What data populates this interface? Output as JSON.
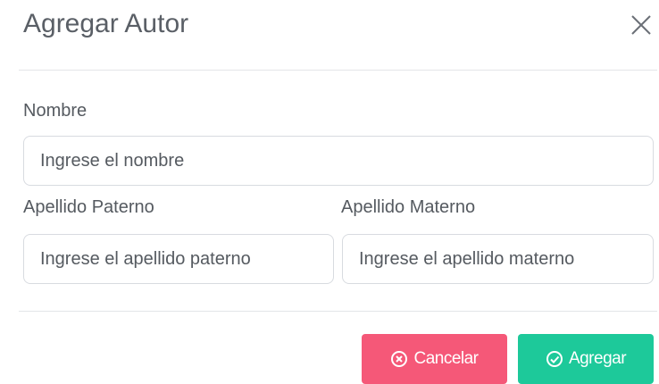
{
  "modal": {
    "title": "Agregar Autor",
    "close_icon": "close-icon"
  },
  "form": {
    "nombre": {
      "label": "Nombre",
      "placeholder": "Ingrese el nombre",
      "value": ""
    },
    "apellido_paterno": {
      "label": "Apellido Paterno",
      "placeholder": "Ingrese el apellido paterno",
      "value": ""
    },
    "apellido_materno": {
      "label": "Apellido Materno",
      "placeholder": "Ingrese el apellido materno",
      "value": ""
    }
  },
  "footer": {
    "cancel_label": "Cancelar",
    "cancel_icon": "x-circle-icon",
    "add_label": "Agregar",
    "add_icon": "check-circle-icon"
  },
  "colors": {
    "cancel": "#f55878",
    "add": "#1dc99a",
    "text": "#555a60"
  }
}
